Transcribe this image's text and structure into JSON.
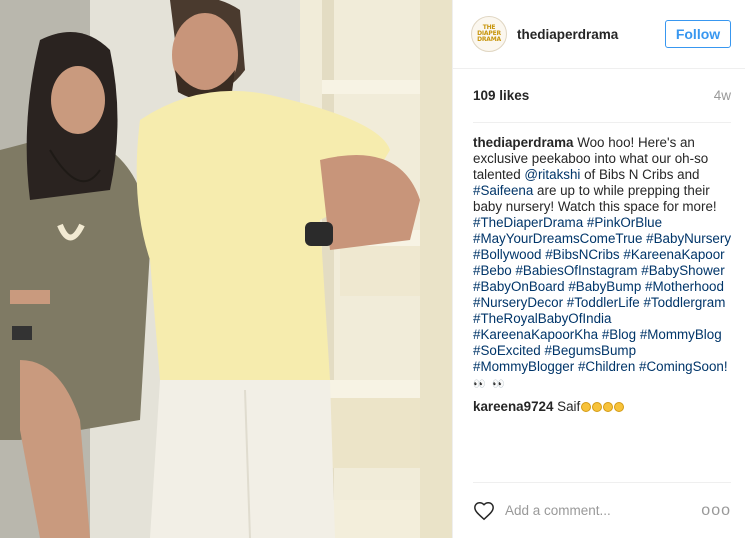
{
  "post": {
    "photo_icon": "photo-of-two-people"
  },
  "header": {
    "avatar_text_line1": "THE DIAPER",
    "avatar_text_line2": "DRAMA",
    "username": "thediaperdrama",
    "follow_label": "Follow"
  },
  "meta": {
    "likes": "109 likes",
    "time": "4w"
  },
  "caption": {
    "user": "thediaperdrama",
    "text1": " Woo hoo! Here's an exclusive peekaboo into what our oh-so talented ",
    "mention1": "@ritakshi",
    "text2": " of Bibs N Cribs and ",
    "mention2": "#Saifeena",
    "text3": " are up to while prepping their baby nursery! Watch this space for more! ",
    "hashtags": [
      "#TheDiaperDrama",
      "#PinkOrBlue",
      "#MayYourDreamsComeTrue",
      "#BabyNursery",
      "#Bollywood",
      "#BibsNCribs",
      "#KareenaKapoor",
      "#Bebo",
      "#BabiesOfInstagram",
      "#BabyShower",
      "#BabyOnBoard",
      "#BabyBump",
      "#Motherhood",
      "#NurseryDecor",
      "#ToddlerLife",
      "#Toddlergram",
      "#TheRoyalBabyOfIndia",
      "#KareenaKapoorKha",
      "#Blog",
      "#MommyBlog",
      "#SoExcited",
      "#BegumsBump",
      "#MommyBlogger",
      "#Children",
      "#ComingSoon!"
    ],
    "trailing_emoji": "👀 👀"
  },
  "comments": [
    {
      "user": "kareena9724",
      "text": " Saif",
      "emoji_count": 4
    }
  ],
  "add_comment": {
    "placeholder": "Add a comment...",
    "more_label": "ooo"
  },
  "colors": {
    "link": "#003569",
    "follow_blue": "#3897f0",
    "muted": "#999999"
  }
}
